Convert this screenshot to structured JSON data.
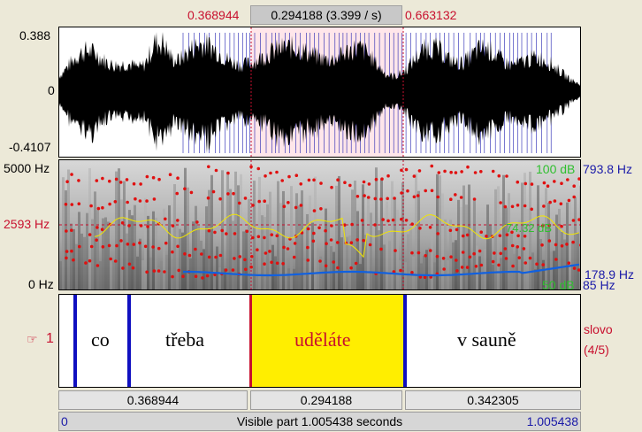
{
  "selection": {
    "start": "0.368944",
    "duration_label": "0.294188 (3.399 / s)",
    "end": "0.663132"
  },
  "waveform": {
    "max": "0.388",
    "zero": "0",
    "min": "-0.4107"
  },
  "spectrogram": {
    "left_top": "5000 Hz",
    "left_cursor": "2593 Hz",
    "left_bottom": "0 Hz",
    "right_top_db": "100 dB",
    "right_top_hz": "793.8 Hz",
    "right_mid_db": "74.32 dB",
    "right_lower_hz": "178.9 Hz",
    "right_bottom_db": "50 dB",
    "right_bottom_hz": "85 Hz"
  },
  "tier": {
    "number": "1",
    "name": "slovo",
    "count": "(4/5)",
    "intervals": [
      "co",
      "třeba",
      "uděláte",
      "v sauně"
    ]
  },
  "segments": [
    "0.368944",
    "0.294188",
    "0.342305"
  ],
  "footer": {
    "left": "0",
    "label": "Visible part 1.005438 seconds",
    "right": "1.005438"
  },
  "colors": {
    "selection": "#ffe6ea",
    "selected_interval": "#ffee00",
    "boundary": "#1010c0",
    "accent_red": "#c8102e"
  }
}
